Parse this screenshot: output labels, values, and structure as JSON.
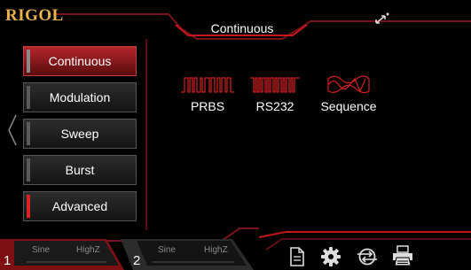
{
  "brand": {
    "logo_text": "RIGOL"
  },
  "header": {
    "title": "Continuous",
    "connection_icon": "usb-connection-icon"
  },
  "menu": {
    "items": [
      {
        "label": "Continuous",
        "active": true
      },
      {
        "label": "Modulation",
        "active": false
      },
      {
        "label": "Sweep",
        "active": false
      },
      {
        "label": "Burst",
        "active": false
      },
      {
        "label": "Advanced",
        "active": false
      }
    ]
  },
  "waveforms": [
    {
      "label": "PRBS",
      "icon": "prbs-wave-icon"
    },
    {
      "label": "RS232",
      "icon": "rs232-wave-icon"
    },
    {
      "label": "Sequence",
      "icon": "sequence-wave-icon"
    }
  ],
  "channels": [
    {
      "number": "1",
      "waveform": "Sine",
      "impedance": "HighZ"
    },
    {
      "number": "2",
      "waveform": "Sine",
      "impedance": "HighZ"
    }
  ],
  "toolbar": {
    "icons": [
      "file-icon",
      "settings-gear-icon",
      "utility-icon",
      "print-icon"
    ]
  },
  "colors": {
    "accent_red": "#c4161c",
    "logo_gold": "#e8b14a"
  }
}
